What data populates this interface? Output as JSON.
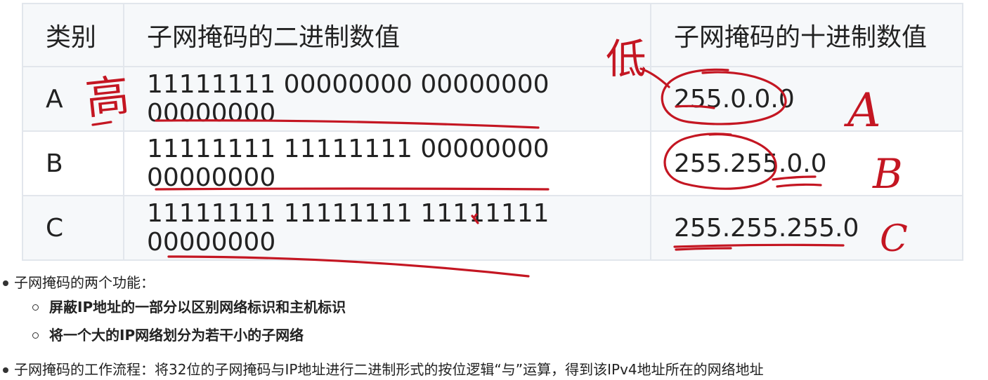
{
  "table": {
    "headers": {
      "category": "类别",
      "binary": "子网掩码的二进制数值",
      "decimal": "子网掩码的十进制数值"
    },
    "rows": [
      {
        "category": "A",
        "binary": "11111111 00000000 00000000 00000000",
        "decimal": "255.0.0.0"
      },
      {
        "category": "B",
        "binary": "11111111 11111111 00000000 00000000",
        "decimal": "255.255.0.0"
      },
      {
        "category": "C",
        "binary": "11111111 11111111 11111111 00000000",
        "decimal": "255.255.255.0"
      }
    ]
  },
  "annotations": {
    "high_char": "高",
    "low_char": "低",
    "letters": [
      "A",
      "B",
      "C"
    ],
    "ink_color": "#c41622"
  },
  "notes": {
    "functions_heading": "子网掩码的两个功能：",
    "functions": [
      "屏蔽IP地址的一部分以区别网络标识和主机标识",
      "将一个大的IP网络划分为若干小的子网络"
    ],
    "workflow_partial": "子网掩码的工作流程：将32位的子网掩码与IP地址进行二进制形式的按位逻辑“与”运算，得到该IPv4地址所在的网络地址"
  }
}
